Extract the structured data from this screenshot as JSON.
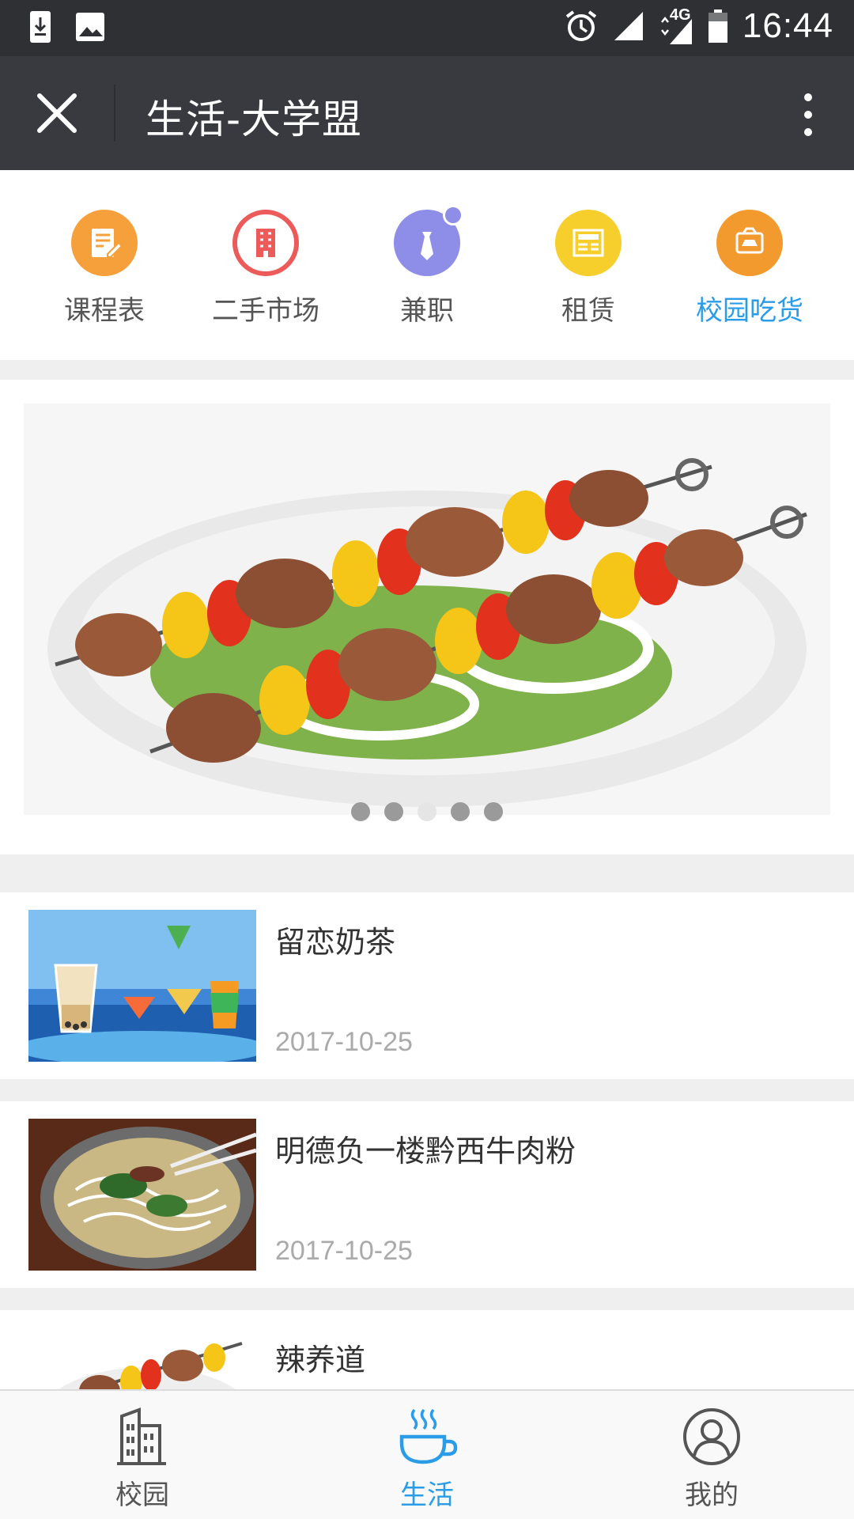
{
  "status_bar": {
    "time": "16:44",
    "network": "4G"
  },
  "title_bar": {
    "title": "生活-大学盟"
  },
  "categories": [
    {
      "label": "课程表",
      "icon": "schedule-icon",
      "color": "#f5a03a"
    },
    {
      "label": "二手市场",
      "icon": "building-icon",
      "color": "#ec5a5a"
    },
    {
      "label": "兼职",
      "icon": "tie-icon",
      "color": "#8e8de8"
    },
    {
      "label": "租赁",
      "icon": "newspaper-icon",
      "color": "#f7cf2d"
    },
    {
      "label": "校园吃货",
      "icon": "car-icon",
      "color": "#f39a2e",
      "active": true
    }
  ],
  "banner": {
    "slides": 5,
    "active_slide": 3
  },
  "list": [
    {
      "title": "留恋奶茶",
      "date": "2017-10-25"
    },
    {
      "title": "明德负一楼黔西牛肉粉",
      "date": "2017-10-25"
    },
    {
      "title": "辣养道",
      "date": ""
    }
  ],
  "tabs": [
    {
      "label": "校园",
      "icon": "building-icon"
    },
    {
      "label": "生活",
      "icon": "coffee-cup-icon",
      "active": true
    },
    {
      "label": "我的",
      "icon": "user-icon"
    }
  ],
  "colors": {
    "accent": "#2a9ce8",
    "titlebar": "#393a3f",
    "statusbar": "#2f3033"
  }
}
